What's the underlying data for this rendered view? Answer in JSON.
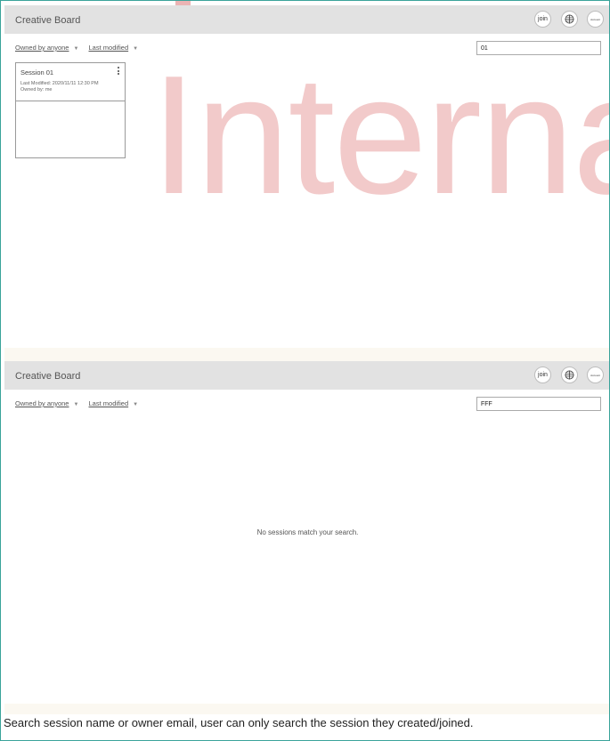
{
  "watermark": {
    "text": "Interna"
  },
  "screens": [
    {
      "app_title": "Creative Board",
      "buttons": {
        "join": "join",
        "account": "Account"
      },
      "filters": {
        "owner": "Owned by anyone",
        "sort": "Last modified"
      },
      "search": {
        "value": "01"
      },
      "sessions": [
        {
          "title": "Session 01",
          "last_modified": "Last Modified: 2020/11/11 12:30 PM",
          "owned_by": "Owned by: me"
        }
      ]
    },
    {
      "app_title": "Creative Board",
      "buttons": {
        "join": "join",
        "account": "Account"
      },
      "filters": {
        "owner": "Owned by anyone",
        "sort": "Last modified"
      },
      "search": {
        "value": "FFF"
      },
      "empty_message": "No sessions match your search."
    }
  ],
  "note": "Search session name or owner email, user can only search the session they created/joined.",
  "colors": {
    "topbar": "#e2e2e2",
    "frame_border": "#3aa39a",
    "watermark": "#eeb9b9"
  },
  "icons": {
    "caret": "caret-down-icon",
    "globe": "globe-icon",
    "kebab": "kebab-menu-icon"
  }
}
